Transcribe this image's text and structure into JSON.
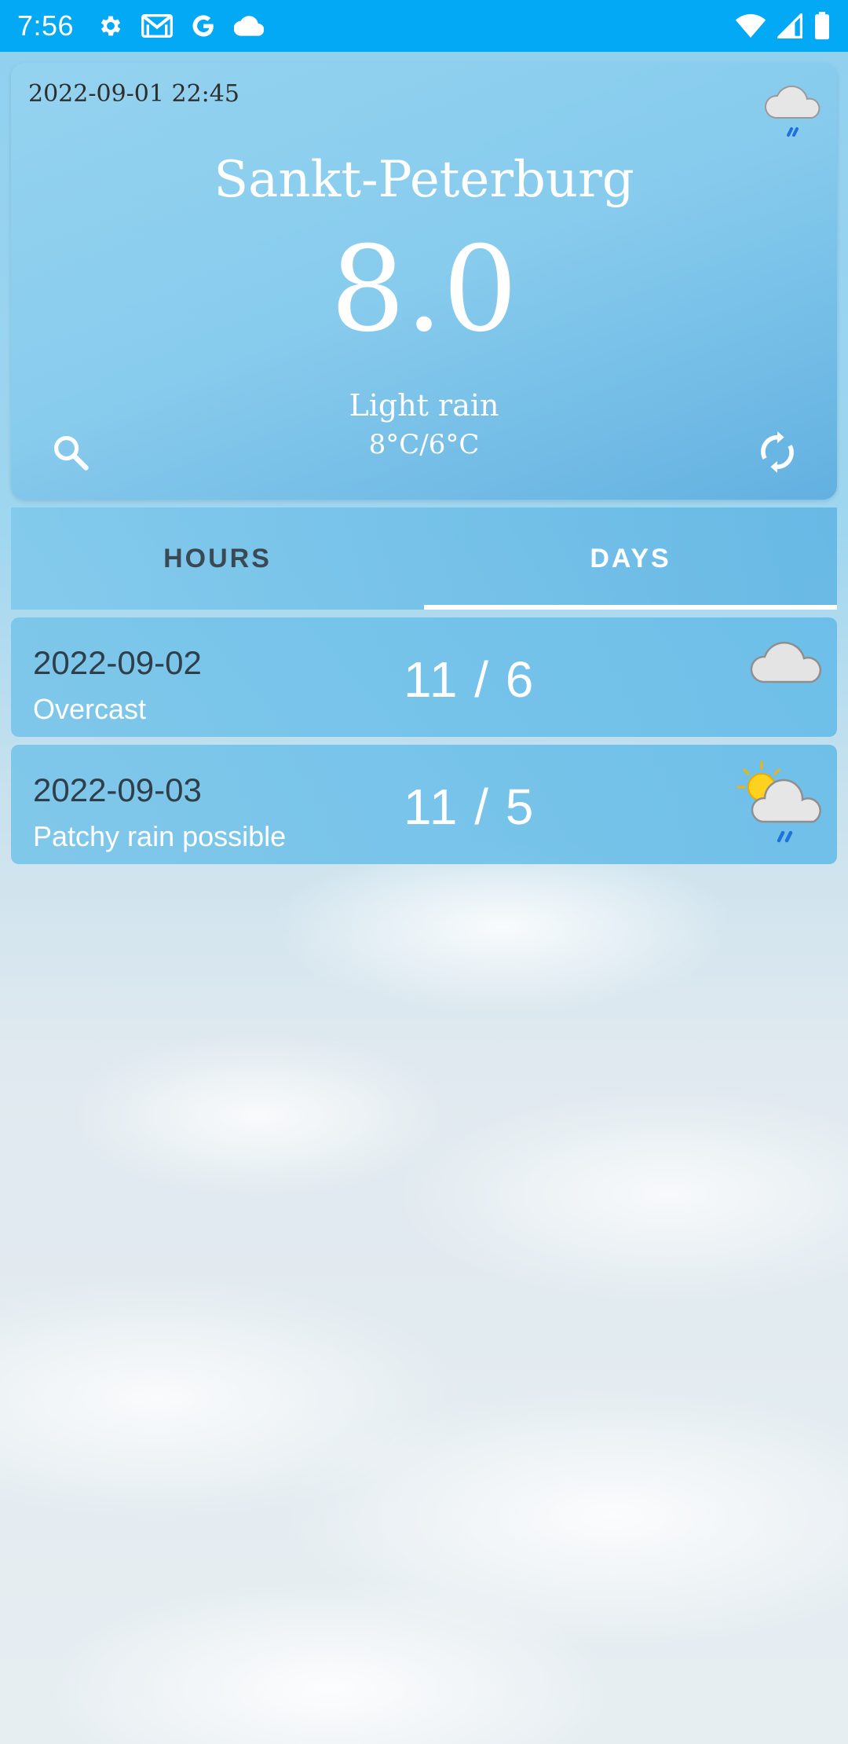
{
  "status_bar": {
    "time": "7:56",
    "left_icons": [
      "settings-icon",
      "gmail-icon",
      "google-icon",
      "cloud-icon"
    ],
    "right_icons": [
      "wifi-icon",
      "signal-icon",
      "battery-icon"
    ]
  },
  "current": {
    "datetime": "2022-09-01 22:45",
    "city": "Sankt-Peterburg",
    "temperature": "8.0",
    "condition": "Light rain",
    "max_min": "8°C/6°C",
    "icon": "light-rain-icon"
  },
  "tabs": [
    {
      "label": "HOURS",
      "selected": false
    },
    {
      "label": "DAYS",
      "selected": true
    }
  ],
  "days": [
    {
      "date": "2022-09-02",
      "condition": "Overcast",
      "temps": "11 / 6",
      "icon": "overcast-icon"
    },
    {
      "date": "2022-09-03",
      "condition": "Patchy rain possible",
      "temps": "11 / 5",
      "icon": "patchy-rain-icon"
    }
  ],
  "colors": {
    "status_bar": "#03a9f4",
    "tab_indicator": "#ffffff",
    "dark_text": "#2f3e48"
  }
}
